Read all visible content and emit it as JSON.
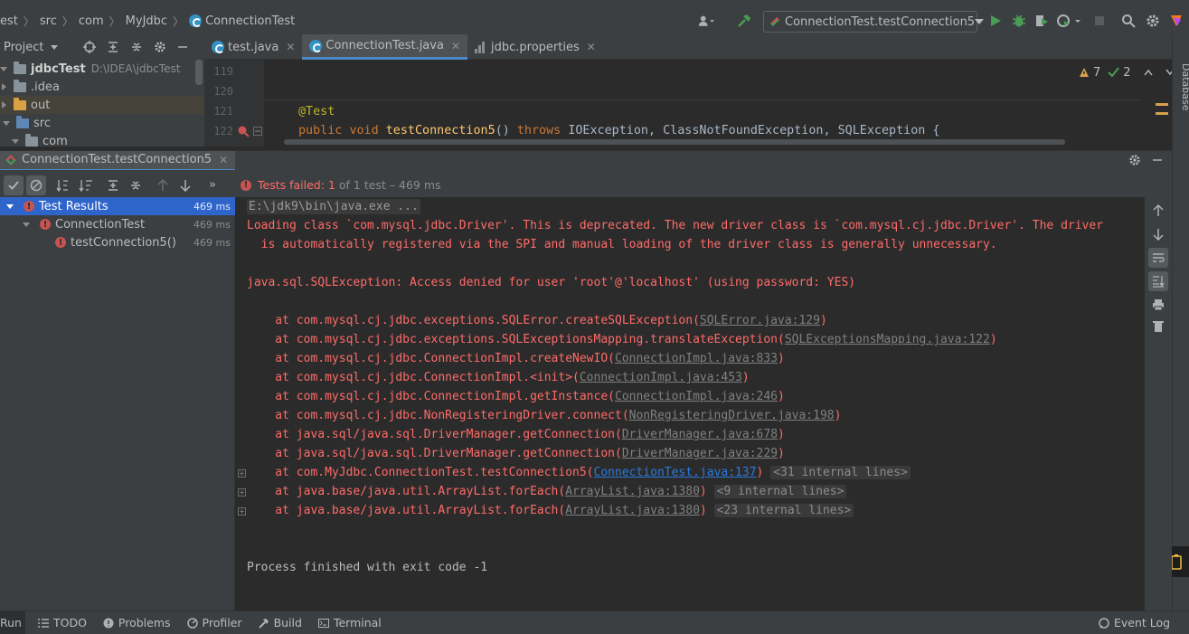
{
  "breadcrumb": [
    "est",
    "src",
    "com",
    "MyJdbc",
    "ConnectionTest"
  ],
  "toolbar": {
    "run_config": "ConnectionTest.testConnection5"
  },
  "project": {
    "header_label": "Project",
    "root_name": "jdbcTest",
    "root_path": "D:\\IDEA\\jdbcTest",
    "items": [
      ".idea",
      "out",
      "src",
      "com"
    ]
  },
  "editor": {
    "tabs": [
      "test.java",
      "ConnectionTest.java",
      "jdbc.properties"
    ],
    "line_numbers": [
      "119",
      "120",
      "121",
      "122"
    ],
    "lines": {
      "annotation": "@Test",
      "kw_public": "public",
      "kw_void": "void",
      "method": "testConnection5",
      "params": "()",
      "kw_throws": "throws",
      "exceptions": "IOException, ClassNotFoundException, SQLException {"
    },
    "warnings": "7",
    "weak_warnings": "2"
  },
  "right_strip": {
    "database_label": "Database"
  },
  "run": {
    "tab_label": "ConnectionTest.testConnection5",
    "status_prefix": "Tests failed:",
    "status_count": "1",
    "status_rest": "of 1 test – 469 ms",
    "tree": [
      {
        "label": "Test Results",
        "time": "469 ms"
      },
      {
        "label": "ConnectionTest",
        "time": "469 ms"
      },
      {
        "label": "testConnection5()",
        "time": "469 ms"
      }
    ]
  },
  "console": {
    "cmd": "E:\\jdk9\\bin\\java.exe ...",
    "warn1": "Loading class `com.mysql.jdbc.Driver'. This is deprecated. The new driver class is `com.mysql.cj.jdbc.Driver'. The driver",
    "warn2": "  is automatically registered via the SPI and manual loading of the driver class is generally unnecessary.",
    "exception": "java.sql.SQLException: Access denied for user 'root'@'localhost' (using password: YES)",
    "frames": [
      {
        "at": "    at com.mysql.cj.jdbc.exceptions.SQLError.createSQLException(",
        "link": "SQLError.java:129",
        "close": ")"
      },
      {
        "at": "    at com.mysql.cj.jdbc.exceptions.SQLExceptionsMapping.translateException(",
        "link": "SQLExceptionsMapping.java:122",
        "close": ")"
      },
      {
        "at": "    at com.mysql.cj.jdbc.ConnectionImpl.createNewIO(",
        "link": "ConnectionImpl.java:833",
        "close": ")"
      },
      {
        "at": "    at com.mysql.cj.jdbc.ConnectionImpl.<init>(",
        "link": "ConnectionImpl.java:453",
        "close": ")"
      },
      {
        "at": "    at com.mysql.cj.jdbc.ConnectionImpl.getInstance(",
        "link": "ConnectionImpl.java:246",
        "close": ")"
      },
      {
        "at": "    at com.mysql.cj.jdbc.NonRegisteringDriver.connect(",
        "link": "NonRegisteringDriver.java:198",
        "close": ")"
      },
      {
        "at": "    at java.sql/java.sql.DriverManager.getConnection(",
        "link": "DriverManager.java:678",
        "close": ")"
      },
      {
        "at": "    at java.sql/java.sql.DriverManager.getConnection(",
        "link": "DriverManager.java:229",
        "close": ")"
      },
      {
        "at": "    at com.MyJdbc.ConnectionTest.testConnection5(",
        "link": "ConnectionTest.java:137",
        "close": ")",
        "fold": "<31 internal lines>"
      },
      {
        "at": "    at java.base/java.util.ArrayList.forEach(",
        "link": "ArrayList.java:1380",
        "close": ")",
        "fold": "<9 internal lines>"
      },
      {
        "at": "    at java.base/java.util.ArrayList.forEach(",
        "link": "ArrayList.java:1380",
        "close": ")",
        "fold": "<23 internal lines>"
      }
    ],
    "finished": "Process finished with exit code -1"
  },
  "bottom": {
    "run": "Run",
    "todo": "TODO",
    "problems": "Problems",
    "profiler": "Profiler",
    "build": "Build",
    "terminal": "Terminal",
    "event_log": "Event Log"
  },
  "icons": {
    "accent": "#4a88c7",
    "error": "#c75450",
    "run_green": "#499c54"
  }
}
